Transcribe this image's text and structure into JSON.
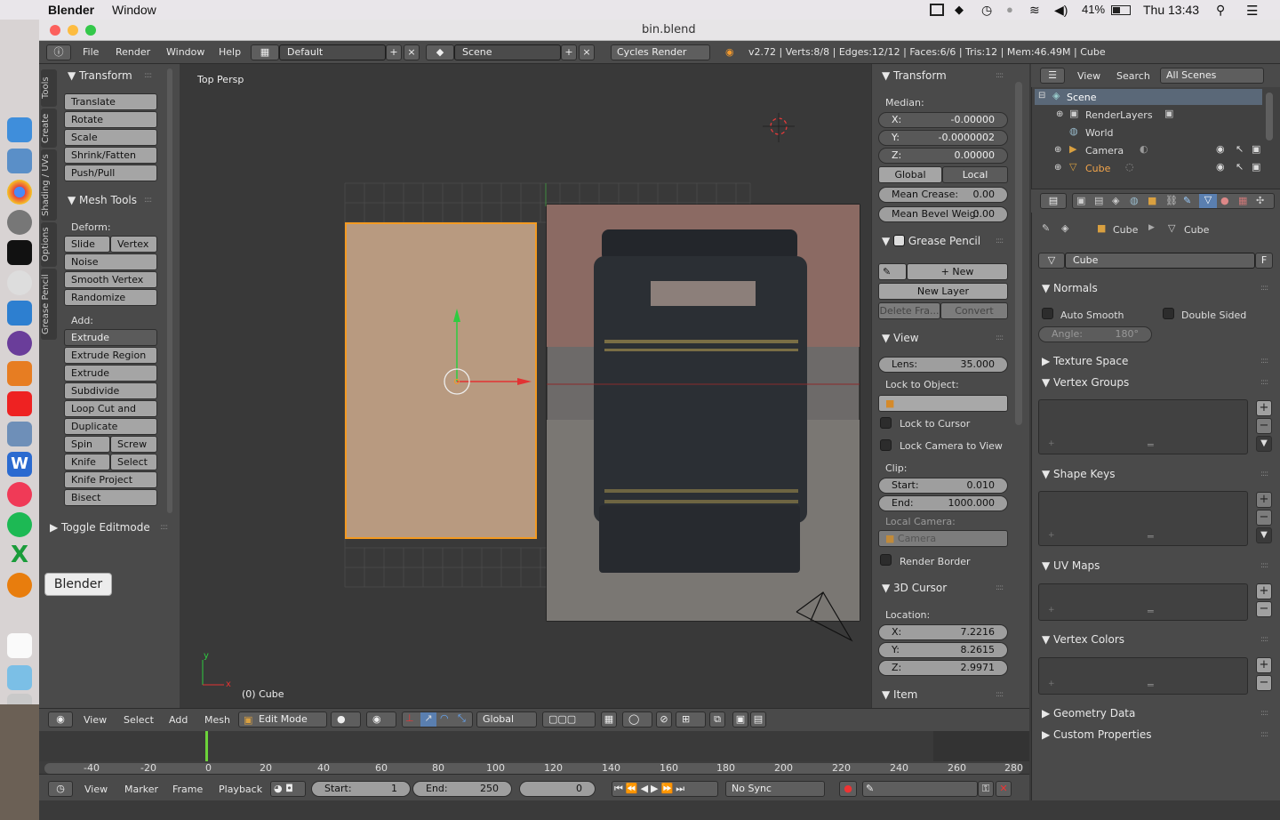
{
  "macos": {
    "app": "Blender",
    "menu": "Window",
    "battery": "41%",
    "clock": "Thu 13:43"
  },
  "window": {
    "title": "bin.blend"
  },
  "dock": {
    "tooltip": "Blender"
  },
  "info": {
    "menus": [
      "File",
      "Render",
      "Window",
      "Help"
    ],
    "layout": "Default",
    "scene": "Scene",
    "engine": "Cycles Render",
    "stats": "v2.72 | Verts:8/8 | Edges:12/12 | Faces:6/6 | Tris:12 | Mem:46.49M | Cube"
  },
  "tools": {
    "tabs": [
      "Tools",
      "Create",
      "Shading / UVs",
      "Options",
      "Grease Pencil"
    ],
    "transform": {
      "title": "Transform",
      "buttons": [
        "Translate",
        "Rotate",
        "Scale",
        "Shrink/Fatten",
        "Push/Pull"
      ]
    },
    "mesh_tools": {
      "title": "Mesh Tools",
      "deform": "Deform:",
      "slide_edge": "Slide Ed",
      "vertex": "Vertex",
      "noise": "Noise",
      "smooth_vertex": "Smooth Vertex",
      "randomize": "Randomize",
      "add": "Add:",
      "extrude": "Extrude",
      "extrude_region": "Extrude Region",
      "extrude_individual": "Extrude Individual",
      "subdivide": "Subdivide",
      "loop_cut": "Loop Cut and Slide",
      "duplicate": "Duplicate",
      "spin": "Spin",
      "screw": "Screw",
      "knife": "Knife",
      "select": "Select",
      "knife_project": "Knife Project",
      "bisect": "Bisect"
    },
    "toggle_editmode": "Toggle Editmode"
  },
  "viewport": {
    "view_label": "Top Persp",
    "object_label": "(0) Cube",
    "axis_x": "x",
    "axis_y": "y"
  },
  "npanel": {
    "transform": "Transform",
    "median": "Median:",
    "x_key": "X:",
    "x_val": "-0.00000",
    "y_key": "Y:",
    "y_val": "-0.0000002",
    "z_key": "Z:",
    "z_val": "0.00000",
    "global": "Global",
    "local": "Local",
    "crease_key": "Mean Crease:",
    "crease_val": "0.00",
    "bevel_key": "Mean Bevel Weig:",
    "bevel_val": "0.00",
    "grease_pencil": "Grease Pencil",
    "new": "New",
    "new_layer": "New Layer",
    "delete_frame": "Delete Fra...",
    "convert": "Convert",
    "view": "View",
    "lens_key": "Lens:",
    "lens_val": "35.000",
    "lock_to_object": "Lock to Object:",
    "lock_to_cursor": "Lock to Cursor",
    "lock_camera": "Lock Camera to View",
    "clip": "Clip:",
    "start_key": "Start:",
    "start_val": "0.010",
    "end_key": "End:",
    "end_val": "1000.000",
    "local_camera": "Local Camera:",
    "camera": "Camera",
    "render_border": "Render Border",
    "cursor": "3D Cursor",
    "location": "Location:",
    "cx": "7.2216",
    "cy": "8.2615",
    "cz": "2.9971",
    "item": "Item"
  },
  "outliner": {
    "view": "View",
    "search": "Search",
    "filter": "All Scenes",
    "items": [
      "Scene",
      "RenderLayers",
      "World",
      "Camera",
      "Cube"
    ]
  },
  "properties": {
    "crumb1": "Cube",
    "crumb2": "Cube",
    "datablock": "Cube",
    "datablock_f": "F",
    "normals": "Normals",
    "auto_smooth": "Auto Smooth",
    "double_sided": "Double Sided",
    "angle_key": "Angle:",
    "angle_val": "180°",
    "texture_space": "Texture Space",
    "vertex_groups": "Vertex Groups",
    "shape_keys": "Shape Keys",
    "uv_maps": "UV Maps",
    "vertex_colors": "Vertex Colors",
    "geometry_data": "Geometry Data",
    "custom_properties": "Custom Properties"
  },
  "view3d_header": {
    "view": "View",
    "select": "Select",
    "add": "Add",
    "mesh": "Mesh",
    "mode": "Edit Mode",
    "orientation": "Global"
  },
  "timeline": {
    "ticks": [
      "-40",
      "-20",
      "0",
      "20",
      "40",
      "60",
      "80",
      "100",
      "120",
      "140",
      "160",
      "180",
      "200",
      "220",
      "240",
      "260",
      "280"
    ],
    "view": "View",
    "marker": "Marker",
    "frame": "Frame",
    "playback": "Playback",
    "start_key": "Start:",
    "start_val": "1",
    "end_key": "End:",
    "end_val": "250",
    "current": "0",
    "sync": "No Sync"
  }
}
